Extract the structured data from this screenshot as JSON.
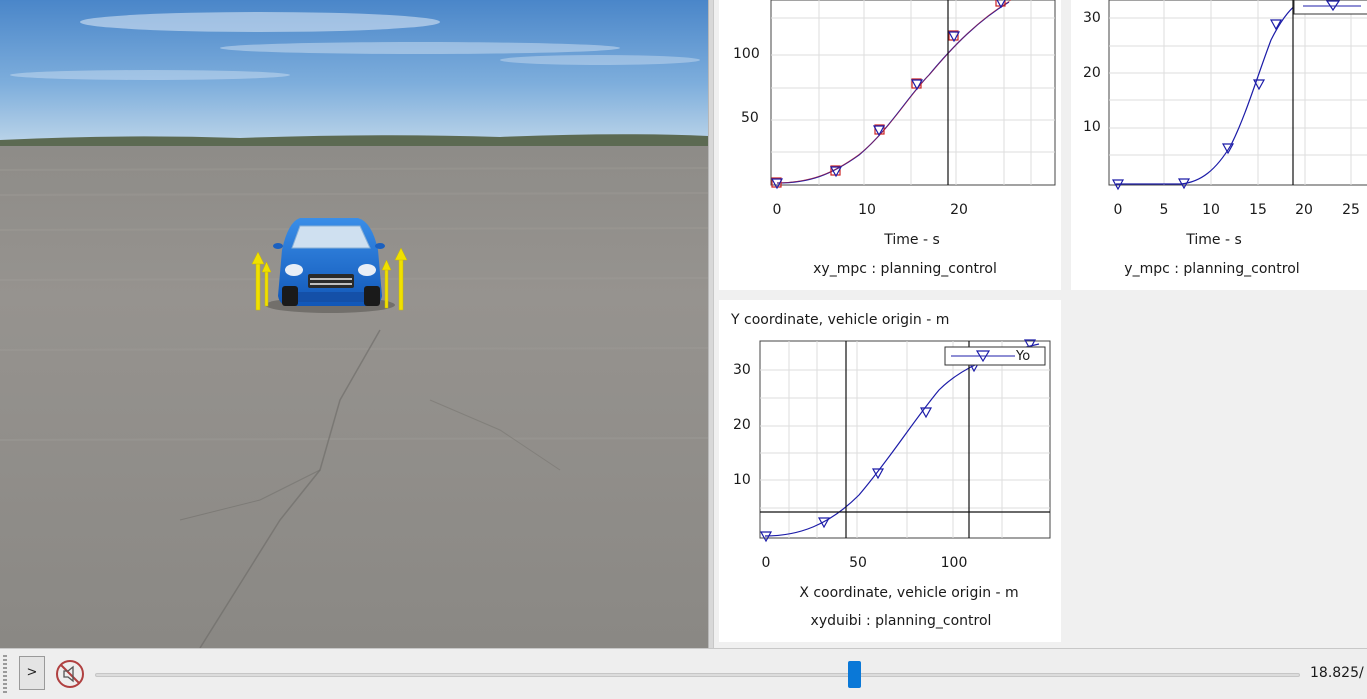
{
  "plots": {
    "xy_mpc": {
      "yticks": [
        "100",
        "50"
      ],
      "xticks": [
        "0",
        "10",
        "20"
      ],
      "xlabel": "Time - s",
      "caption": "xy_mpc : planning_control"
    },
    "y_mpc": {
      "yticks": [
        "30",
        "20",
        "10"
      ],
      "xticks": [
        "0",
        "5",
        "10",
        "15",
        "20",
        "25"
      ],
      "xlabel": "Time - s",
      "caption": "y_mpc : planning_control"
    },
    "xyduibi": {
      "title": "Y coordinate, vehicle origin - m",
      "yticks": [
        "30",
        "20",
        "10"
      ],
      "xticks": [
        "0",
        "50",
        "100"
      ],
      "xlabel": "X coordinate, vehicle origin - m",
      "caption": "xyduibi : planning_control",
      "legend_label": "Yo"
    }
  },
  "playback": {
    "play_label": ">",
    "progress": 0.63,
    "time_text": "18.825/"
  },
  "colors": {
    "series_blue": "#1c1ca8",
    "series_red": "#cc2222",
    "slider_thumb": "#0a78d7"
  }
}
